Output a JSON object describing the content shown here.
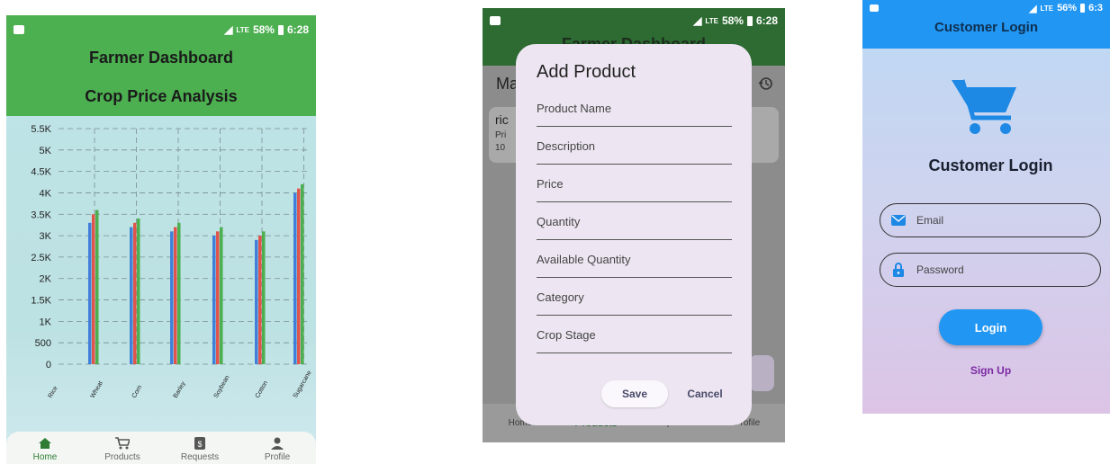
{
  "screen1": {
    "status": {
      "battery": "58%",
      "time": "6:28",
      "network": "LTE"
    },
    "app_title": "Farmer Dashboard",
    "chart_title": "Crop Price Analysis",
    "colors": {
      "header": "#4caf50",
      "series1": "#3f7fd9",
      "series2": "#e0544b",
      "series3": "#4caf50"
    },
    "nav": [
      {
        "label": "Home",
        "icon": "home-icon"
      },
      {
        "label": "Products",
        "icon": "cart-icon"
      },
      {
        "label": "Requests",
        "icon": "request-icon"
      },
      {
        "label": "Profile",
        "icon": "person-icon"
      }
    ]
  },
  "chart_data": {
    "type": "bar",
    "title": "Crop Price Analysis",
    "categories": [
      "Rice",
      "Wheat",
      "Corn",
      "Barley",
      "Soybean",
      "Cotton",
      "Sugarcane"
    ],
    "series": [
      {
        "values": [
          3300,
          3200,
          3100,
          3000,
          2900,
          4000,
          0
        ]
      },
      {
        "values": [
          3500,
          3300,
          3200,
          3100,
          3000,
          4100,
          0
        ]
      },
      {
        "values": [
          3600,
          3400,
          3300,
          3200,
          3100,
          4200,
          0
        ]
      }
    ],
    "group_values": [
      [
        3300,
        3500,
        3600
      ],
      [
        3200,
        3300,
        3400
      ],
      [
        3100,
        3200,
        3300
      ],
      [
        3000,
        3100,
        3200
      ],
      [
        2900,
        3000,
        3100
      ],
      [
        4000,
        4100,
        4200
      ]
    ],
    "yticks": [
      "0",
      "500",
      "1K",
      "1.5K",
      "2K",
      "2.5K",
      "3K",
      "3.5K",
      "4K",
      "4.5K",
      "5K",
      "5.5K"
    ],
    "xticks": [
      "Rice",
      "Wheat",
      "Corn",
      "Barley",
      "Soybean",
      "Cotton",
      "Sugarcane"
    ],
    "ylim": [
      0,
      5500
    ],
    "grid": true
  },
  "screen2": {
    "status": {
      "battery": "58%",
      "time": "6:28",
      "network": "LTE"
    },
    "app_title": "Farmer Dashboard",
    "background": {
      "heading": "Ma",
      "card_title": "ric",
      "card_line2": "Pri",
      "card_line3": "10"
    },
    "dialog": {
      "title": "Add Product",
      "fields": [
        "Product Name",
        "Description",
        "Price",
        "Quantity",
        "Available Quantity",
        "Category",
        "Crop Stage"
      ],
      "save": "Save",
      "cancel": "Cancel"
    },
    "nav": [
      {
        "label": "Home"
      },
      {
        "label": "Products"
      },
      {
        "label": "Requests"
      },
      {
        "label": "Profile"
      }
    ]
  },
  "screen3": {
    "status": {
      "battery": "56%",
      "time": "6:3",
      "network": "LTE"
    },
    "app_title": "Customer Login",
    "heading": "Customer Login",
    "email_placeholder": "Email",
    "password_placeholder": "Password",
    "login": "Login",
    "signup": "Sign Up",
    "colors": {
      "primary": "#2196f3",
      "link": "#7b2aa3"
    }
  }
}
